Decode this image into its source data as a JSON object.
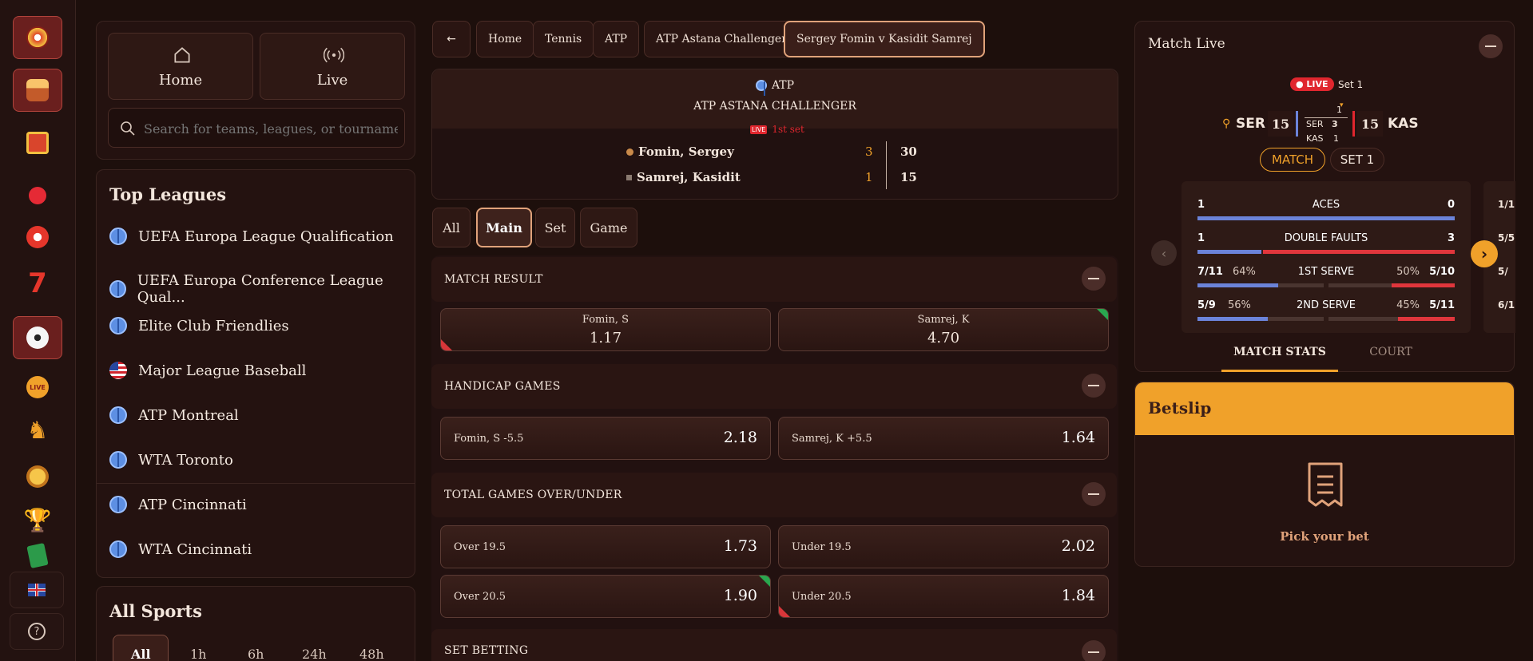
{
  "colors": {
    "accent": "#f0a12a",
    "live_red": "#e0262e",
    "panel": "#241210",
    "stat_blue": "#6b83d9",
    "stat_red": "#e0363c"
  },
  "rail": {
    "icons": [
      "roulette-icon",
      "cake-icon",
      "gift-icon",
      "cherry-icon",
      "play-chip-icon",
      "seven-icon",
      "soccer-ball-icon",
      "live-icon",
      "chess-knight-icon",
      "medal-icon",
      "trophy-icon",
      "cards-icon"
    ],
    "language": "UK flag",
    "help": "?"
  },
  "nav": {
    "home_label": "Home",
    "live_label": "Live"
  },
  "search": {
    "placeholder": "Search for teams, leagues, or tournaments"
  },
  "top_leagues": {
    "title": "Top Leagues",
    "items": [
      {
        "label": "UEFA Europa League Qualification",
        "icon": "globe-icon"
      },
      {
        "label": "UEFA Europa Conference League Qual...",
        "icon": "globe-icon"
      },
      {
        "label": "Elite Club Friendlies",
        "icon": "globe-icon"
      },
      {
        "label": "Major League Baseball",
        "icon": "us-flag-icon"
      },
      {
        "label": "ATP Montreal",
        "icon": "globe-icon"
      },
      {
        "label": "WTA Toronto",
        "icon": "globe-icon"
      },
      {
        "label": "ATP Cincinnati",
        "icon": "globe-icon"
      },
      {
        "label": "WTA Cincinnati",
        "icon": "globe-icon"
      }
    ]
  },
  "all_sports": {
    "title": "All Sports",
    "filters": [
      "All",
      "1h",
      "6h",
      "24h",
      "48h"
    ],
    "active_filter": "All"
  },
  "breadcrumb": {
    "back": "←",
    "items": [
      "Home",
      "Tennis",
      "ATP",
      "ATP Astana Challenger",
      "Sergey Fomin v Kasidit Samrej"
    ]
  },
  "match": {
    "category": "ATP",
    "tournament": "ATP ASTANA CHALLENGER",
    "live_badge": "LIVE",
    "period": "1st set",
    "players": [
      {
        "name": "Fomin, Sergey",
        "sets": "3",
        "points": "30"
      },
      {
        "name": "Samrej, Kasidit",
        "sets": "1",
        "points": "15"
      }
    ]
  },
  "market_tabs": {
    "items": [
      "All",
      "Main",
      "Set",
      "Game"
    ],
    "active": "Main"
  },
  "markets": {
    "match_result": {
      "title": "MATCH RESULT",
      "odds": [
        {
          "label": "Fomin, S",
          "value": "1.17"
        },
        {
          "label": "Samrej, K",
          "value": "4.70"
        }
      ]
    },
    "handicap": {
      "title": "HANDICAP GAMES",
      "odds": [
        {
          "label": "Fomin, S -5.5",
          "value": "2.18"
        },
        {
          "label": "Samrej, K +5.5",
          "value": "1.64"
        }
      ]
    },
    "totals": {
      "title": "TOTAL GAMES OVER/UNDER",
      "odds": [
        {
          "label": "Over 19.5",
          "value": "1.73"
        },
        {
          "label": "Under 19.5",
          "value": "2.02"
        },
        {
          "label": "Over 20.5",
          "value": "1.90"
        },
        {
          "label": "Under 20.5",
          "value": "1.84"
        }
      ]
    },
    "set_betting": {
      "title": "SET BETTING"
    }
  },
  "match_live": {
    "title": "Match Live",
    "live_badge": "● LIVE",
    "set_label": "Set 1",
    "home": {
      "abbr": "SER",
      "points": "15",
      "games": "3",
      "serve_games": "1"
    },
    "away": {
      "abbr": "KAS",
      "points": "15",
      "games": "1"
    },
    "toggle": [
      "MATCH",
      "SET 1"
    ],
    "stats": [
      {
        "name": "ACES",
        "left": "1",
        "right": "0",
        "left_frac": 1.0,
        "right_frac": 0.0
      },
      {
        "name": "DOUBLE FAULTS",
        "left": "1",
        "right": "3",
        "left_frac": 0.25,
        "right_frac": 0.75
      },
      {
        "name": "1ST SERVE",
        "left": "7/11",
        "left_pct": "64%",
        "right": "5/10",
        "right_pct": "50%",
        "left_frac": 0.64,
        "right_frac": 0.5
      },
      {
        "name": "2ND SERVE",
        "left": "5/9",
        "left_pct": "56%",
        "right": "5/11",
        "right_pct": "45%",
        "left_frac": 0.56,
        "right_frac": 0.45
      }
    ],
    "next_card_peek": [
      "1/1",
      "5/5",
      "5/",
      "6/1"
    ],
    "tabs": [
      "MATCH STATS",
      "COURT"
    ]
  },
  "betslip": {
    "title": "Betslip",
    "empty": "Pick your bet"
  }
}
